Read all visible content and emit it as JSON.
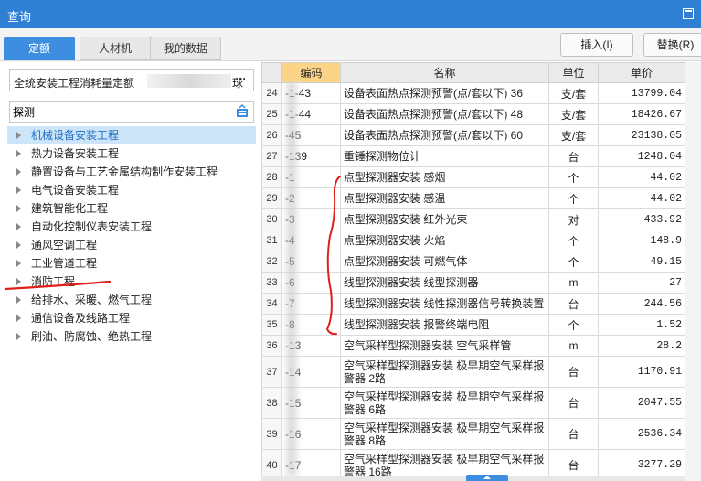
{
  "window": {
    "title": "查询"
  },
  "tabs": [
    {
      "label": "定额",
      "active": true
    },
    {
      "label": "人材机",
      "active": false
    },
    {
      "label": "我的数据",
      "active": false
    }
  ],
  "actions": {
    "insert_label": "插入(I)",
    "replace_label": "替换(R)"
  },
  "left": {
    "quota_library_value": "全统安装工程消耗量定额",
    "quota_library_suffix": "球",
    "more_label": "···",
    "search_value": "探测",
    "search_icon": "search-filter-icon",
    "tree": [
      {
        "label": "机械设备安装工程",
        "selected": true
      },
      {
        "label": "热力设备安装工程",
        "selected": false
      },
      {
        "label": "静置设备与工艺金属结构制作安装工程",
        "selected": false
      },
      {
        "label": "电气设备安装工程",
        "selected": false
      },
      {
        "label": "建筑智能化工程",
        "selected": false
      },
      {
        "label": "自动化控制仪表安装工程",
        "selected": false
      },
      {
        "label": "通风空调工程",
        "selected": false
      },
      {
        "label": "工业管道工程",
        "selected": false
      },
      {
        "label": "消防工程",
        "selected": false
      },
      {
        "label": "给排水、采暖、燃气工程",
        "selected": false
      },
      {
        "label": "通信设备及线路工程",
        "selected": false
      },
      {
        "label": "刷油、防腐蚀、绝热工程",
        "selected": false
      }
    ]
  },
  "grid": {
    "columns": {
      "index": "",
      "code": "编码",
      "name": "名称",
      "unit": "单位",
      "price": "单价"
    },
    "rows": [
      {
        "index": "24",
        "code": "-1-43",
        "name": "设备表面热点探测预警(点/套以下) 36",
        "unit": "支/套",
        "price": "13799.04"
      },
      {
        "index": "25",
        "code": "-1-44",
        "name": "设备表面热点探测预警(点/套以下) 48",
        "unit": "支/套",
        "price": "18426.67"
      },
      {
        "index": "26",
        "code": "-45",
        "name": "设备表面热点探测预警(点/套以下) 60",
        "unit": "支/套",
        "price": "23138.05"
      },
      {
        "index": "27",
        "code": "-139",
        "name": "重锤探测物位计",
        "unit": "台",
        "price": "1248.04"
      },
      {
        "index": "28",
        "code": "-1",
        "name": "点型探测器安装 感烟",
        "unit": "个",
        "price": "44.02"
      },
      {
        "index": "29",
        "code": "-2",
        "name": "点型探测器安装 感温",
        "unit": "个",
        "price": "44.02"
      },
      {
        "index": "30",
        "code": "-3",
        "name": "点型探测器安装 红外光束",
        "unit": "对",
        "price": "433.92"
      },
      {
        "index": "31",
        "code": "-4",
        "name": "点型探测器安装 火焰",
        "unit": "个",
        "price": "148.9"
      },
      {
        "index": "32",
        "code": "-5",
        "name": "点型探测器安装 可燃气体",
        "unit": "个",
        "price": "49.15"
      },
      {
        "index": "33",
        "code": "-6",
        "name": "线型探测器安装 线型探测器",
        "unit": "m",
        "price": "27"
      },
      {
        "index": "34",
        "code": "-7",
        "name": "线型探测器安装 线性探测器信号转换装置",
        "unit": "台",
        "price": "244.56"
      },
      {
        "index": "35",
        "code": "-8",
        "name": "线型探测器安装 报警终端电阻",
        "unit": "个",
        "price": "1.52"
      },
      {
        "index": "36",
        "code": "-13",
        "name": "空气采样型探测器安装 空气采样管",
        "unit": "m",
        "price": "28.2"
      },
      {
        "index": "37",
        "code": "-14",
        "name": "空气采样型探测器安装 极早期空气采样报警器 2路",
        "unit": "台",
        "price": "1170.91"
      },
      {
        "index": "38",
        "code": "-15",
        "name": "空气采样型探测器安装 极早期空气采样报警器 6路",
        "unit": "台",
        "price": "2047.55"
      },
      {
        "index": "39",
        "code": "-16",
        "name": "空气采样型探测器安装 极早期空气采样报警器 8路",
        "unit": "台",
        "price": "2536.34"
      },
      {
        "index": "40",
        "code": "-17",
        "name": "空气采样型探测器安装 极早期空气采样报警器 16路",
        "unit": "台",
        "price": "3277.29"
      }
    ]
  },
  "colors": {
    "accent": "#3d8ee0",
    "titlebar": "#2f7fd3",
    "header_highlight": "#fcd487",
    "annotation_red": "#e0201c"
  }
}
